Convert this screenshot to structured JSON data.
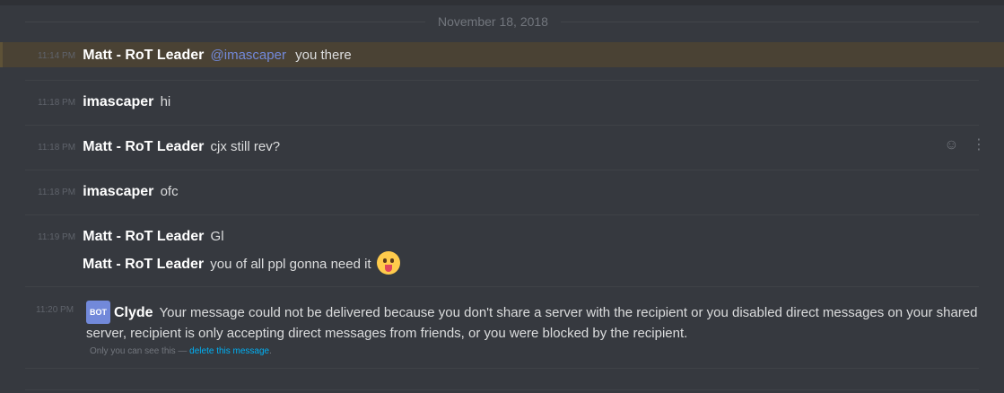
{
  "date_divider": "November 18, 2018",
  "messages": [
    {
      "time": "11:14 PM",
      "author": "Matt - RoT Leader",
      "mention": "@imascaper",
      "text": "you there"
    },
    {
      "time": "11:18 PM",
      "author": "imascaper",
      "text": "hi"
    },
    {
      "time": "11:18 PM",
      "author": "Matt - RoT Leader",
      "text": "cjx still rev?"
    },
    {
      "time": "11:18 PM",
      "author": "imascaper",
      "text": "ofc"
    },
    {
      "time": "11:19 PM",
      "author": "Matt - RoT Leader",
      "text": "Gl"
    },
    {
      "author": "Matt - RoT Leader",
      "text": "you of all ppl gonna need it",
      "emoji": "tongue-out-emoji"
    }
  ],
  "clyde": {
    "time": "11:20 PM",
    "badge": "BOT",
    "author": "Clyde",
    "text": "Your message could not be delivered because you don't share a server with the recipient or you disabled direct messages on your shared server, recipient is only accepting direct messages from friends, or you were blocked by the recipient.",
    "ephemeral_note": "Only you can see this —",
    "delete_link": "delete this message",
    "delete_suffix": "."
  },
  "hover_icons": [
    "add-reaction-icon",
    "more-options-icon"
  ],
  "colors": {
    "background": "#36393f",
    "highlight": "#4a4234",
    "mention": "#7289da",
    "link": "#00b0f4"
  }
}
